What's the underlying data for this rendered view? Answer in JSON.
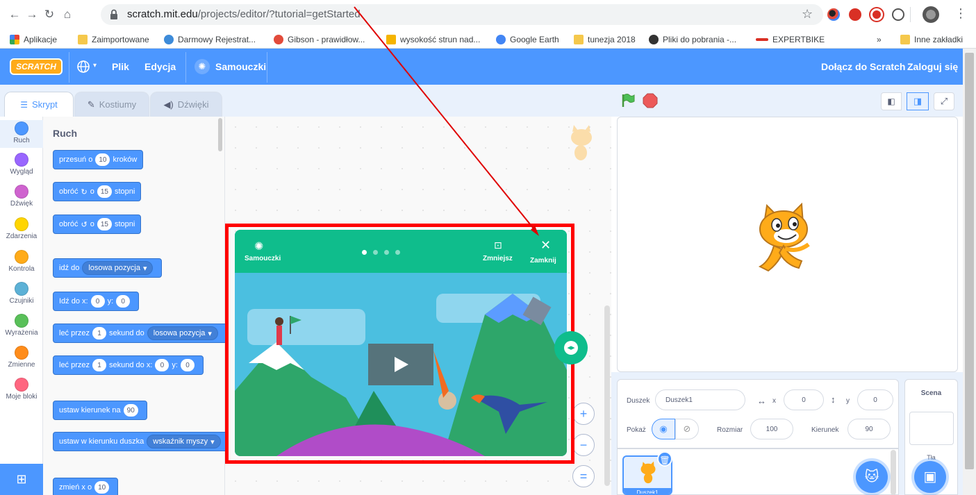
{
  "browser": {
    "url_host": "scratch.mit.edu",
    "url_path": "/projects/editor/?tutorial=getStarted",
    "bookmarks": [
      {
        "label": "Aplikacje",
        "color": "#e94235"
      },
      {
        "label": "Zaimportowane",
        "color": "#f5c84c"
      },
      {
        "label": "Darmowy Rejestrat...",
        "color": "#3d8bd9"
      },
      {
        "label": "Gibson - prawidłow...",
        "color": "#e24b3b"
      },
      {
        "label": "wysokość strun nad...",
        "color": "#f5b400"
      },
      {
        "label": "Google Earth",
        "color": "#4285f4"
      },
      {
        "label": "tunezja 2018",
        "color": "#f5c84c"
      },
      {
        "label": "Pliki do pobrania -...",
        "color": "#333333"
      },
      {
        "label": "EXPERTBIKE",
        "color": "#d93025"
      }
    ],
    "more": "»",
    "other_bookmarks": "Inne zakładki"
  },
  "menubar": {
    "logo": "SCRATCH",
    "file": "Plik",
    "edit": "Edycja",
    "tutorials": "Samouczki",
    "join": "Dołącz do Scratch",
    "login": "Zaloguj się"
  },
  "tabs": {
    "code": "Skrypt",
    "costumes": "Kostiumy",
    "sounds": "Dźwięki"
  },
  "categories": [
    {
      "label": "Ruch",
      "color": "#4c97ff"
    },
    {
      "label": "Wygląd",
      "color": "#9966ff"
    },
    {
      "label": "Dźwięk",
      "color": "#cf63cf"
    },
    {
      "label": "Zdarzenia",
      "color": "#ffd500"
    },
    {
      "label": "Kontrola",
      "color": "#ffab19"
    },
    {
      "label": "Czujniki",
      "color": "#5cb1d6"
    },
    {
      "label": "Wyrażenia",
      "color": "#59c059"
    },
    {
      "label": "Zmienne",
      "color": "#ff8c1a"
    },
    {
      "label": "Moje bloki",
      "color": "#ff6680"
    }
  ],
  "palette": {
    "title": "Ruch",
    "blocks": {
      "move_a": "przesuń o",
      "move_val": "10",
      "move_b": "kroków",
      "turn_r_a": "obróć",
      "turn_r_o": "o",
      "turn_r_val": "15",
      "turn_r_b": "stopni",
      "turn_l_a": "obróć",
      "turn_l_o": "o",
      "turn_l_val": "15",
      "turn_l_b": "stopni",
      "goto_a": "idź do",
      "goto_drop": "losowa pozycja",
      "gotoxy_a": "Idź do x:",
      "gotoxy_x": "0",
      "gotoxy_y_lbl": "y:",
      "gotoxy_y": "0",
      "glide_a": "leć przez",
      "glide_val": "1",
      "glide_b": "sekund do",
      "glide_drop": "losowa pozycja",
      "glidexy_a": "leć przez",
      "glidexy_val": "1",
      "glidexy_b": "sekund do x:",
      "glidexy_x": "0",
      "glidexy_y_lbl": "y:",
      "glidexy_y": "0",
      "point_a": "ustaw kierunek na",
      "point_val": "90",
      "towards_a": "ustaw w kierunku duszka",
      "towards_drop": "wskaźnik myszy",
      "changex_a": "zmień x o",
      "changex_val": "10"
    }
  },
  "modal": {
    "tutorials_label": "Samouczki",
    "shrink_label": "Zmniejsz",
    "close_label": "Zamknij",
    "page_count": 4,
    "current_page": 1
  },
  "sprite_info": {
    "sprite_label": "Duszek",
    "sprite_name": "Duszek1",
    "x_label": "x",
    "x_value": "0",
    "y_label": "y",
    "y_value": "0",
    "show_label": "Pokaż",
    "size_label": "Rozmiar",
    "size_value": "100",
    "direction_label": "Kierunek",
    "direction_value": "90"
  },
  "sprite_list": {
    "item_name": "Duszek1"
  },
  "scene": {
    "title": "Scena",
    "backdrops": "Tła"
  },
  "zoom": {
    "in": "+",
    "out": "−",
    "reset": "="
  }
}
